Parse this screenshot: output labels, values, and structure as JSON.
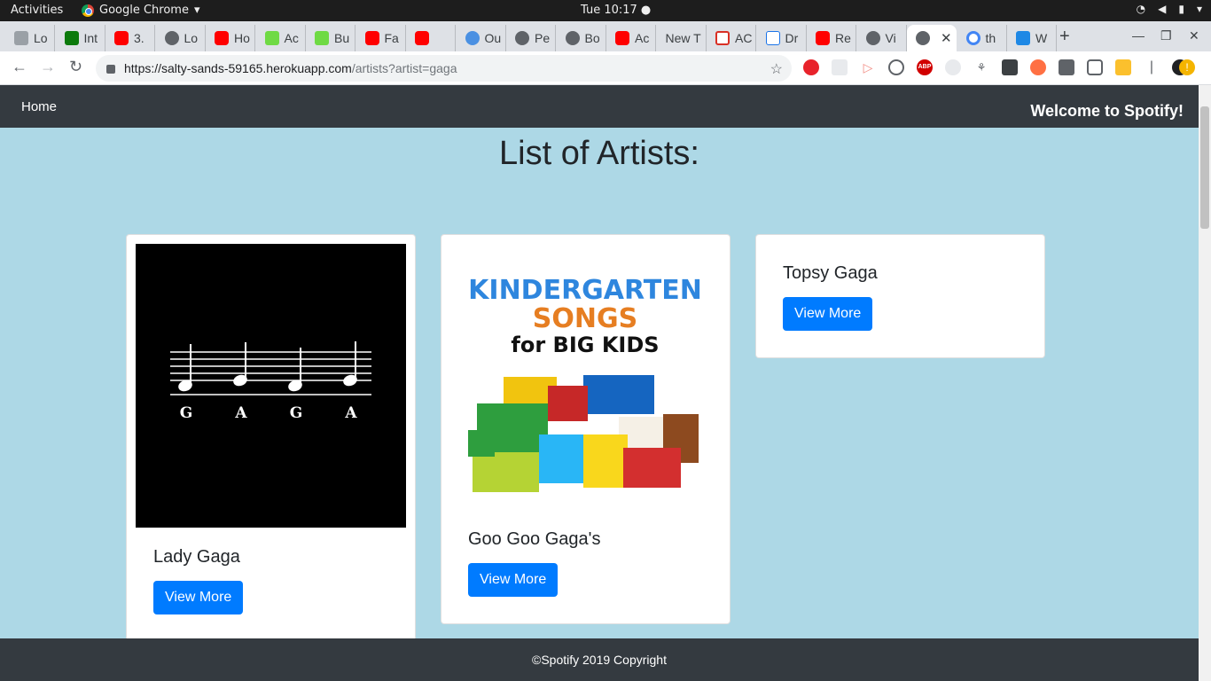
{
  "system": {
    "activities": "Activities",
    "app_name": "Google Chrome",
    "clock": "Tue 10:17 ●"
  },
  "tabs": [
    {
      "label": "Lo",
      "icon": "lock-icon"
    },
    {
      "label": "Int",
      "icon": "terminal-icon"
    },
    {
      "label": "3.",
      "icon": "youtube-icon"
    },
    {
      "label": "Lo",
      "icon": "globe-icon"
    },
    {
      "label": "Ho",
      "icon": "youtube-icon"
    },
    {
      "label": "Ac",
      "icon": "upwork-icon"
    },
    {
      "label": "Bu",
      "icon": "upwork-icon"
    },
    {
      "label": "Fa",
      "icon": "youtube-icon"
    },
    {
      "label": "",
      "icon": "youtube-icon"
    },
    {
      "label": "Ou",
      "icon": "spiral-icon"
    },
    {
      "label": "Pe",
      "icon": "globe-icon"
    },
    {
      "label": "Bo",
      "icon": "globe-icon"
    },
    {
      "label": "Ac",
      "icon": "youtube-icon"
    },
    {
      "label": "New T",
      "icon": ""
    },
    {
      "label": "AC",
      "icon": "gmail-icon"
    },
    {
      "label": "Dr",
      "icon": "info-icon"
    },
    {
      "label": "Re",
      "icon": "youtube-icon"
    },
    {
      "label": "Vi",
      "icon": "globe-icon"
    },
    {
      "label": "",
      "icon": "globe-icon",
      "active": true
    },
    {
      "label": "th",
      "icon": "google-icon"
    },
    {
      "label": "W",
      "icon": "td-icon"
    }
  ],
  "toolbar": {
    "url_host": "https://salty-sands-59165.herokuapp.com",
    "url_path": "/artists?artist=gaga"
  },
  "page": {
    "nav_home": "Home",
    "nav_welcome": "Welcome to Spotify!",
    "heading": "List of Artists:",
    "footer": "©Spotify 2019 Copyright",
    "artists": [
      {
        "name": "Lady Gaga",
        "button": "View More",
        "image": "gaga-notes-art"
      },
      {
        "name": "Goo Goo Gaga's",
        "button": "View More",
        "image": "kindergarten-songs-art",
        "image_text": {
          "line1": "KINDERGARTEN",
          "line2": "SONGS",
          "line3": "for BIG KIDS"
        }
      },
      {
        "name": "Topsy Gaga",
        "button": "View More"
      }
    ],
    "gaga_letters": [
      "G",
      "A",
      "G",
      "A"
    ]
  }
}
